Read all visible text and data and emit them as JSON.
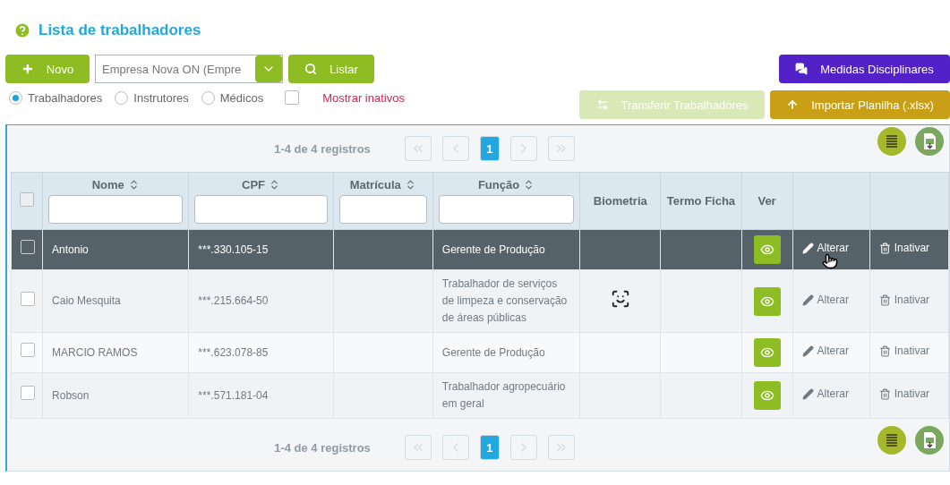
{
  "title": "Lista de trabalhadores",
  "toolbar": {
    "new_button": "Novo",
    "company_select": {
      "value": "Empresa Nova ON (Empre"
    },
    "list_button": "Listar",
    "disciplinary_button": "Medidas Disciplinares"
  },
  "filters": [
    {
      "label": "Trabalhadores",
      "selected": true
    },
    {
      "label": "Instrutores",
      "selected": false
    },
    {
      "label": "Médicos",
      "selected": false
    }
  ],
  "show_inactive": {
    "label": "Mostrar inativos",
    "checked": false
  },
  "actions": [
    {
      "label": "Transferir Trabalhadores",
      "kind": "transfer",
      "disabled": true
    },
    {
      "label": "Importar Planilha (.xlsx)",
      "kind": "import",
      "disabled": false
    }
  ],
  "pagination_top": {
    "summary": "1-4 de 4 registros",
    "pages": [
      {
        "label": "1",
        "selected": true
      }
    ]
  },
  "table": {
    "select_all": {
      "checked": false
    },
    "columns": [
      {
        "label": "Nome",
        "sortable": true,
        "filter": true
      },
      {
        "label": "CPF",
        "sortable": true,
        "filter": true
      },
      {
        "label": "Matrícula",
        "sortable": true,
        "filter": true
      },
      {
        "label": "Função",
        "sortable": true,
        "filter": true
      },
      {
        "label": "Biometria",
        "sortable": false,
        "filter": false
      },
      {
        "label": "Termo Ficha",
        "sortable": false,
        "filter": false
      },
      {
        "label": "Ver",
        "sortable": false,
        "filter": false
      }
    ],
    "rows": [
      {
        "name": "Antonio",
        "cpf": "***.330.105-15",
        "role": "Gerente de Produção",
        "biometry": false,
        "checked": false,
        "highlighted": true,
        "edit": "Alterar",
        "deactivate": "Inativar"
      },
      {
        "name": "Caio Mesquita",
        "cpf": "***.215.664-50",
        "role": "Trabalhador de serviços de limpeza e conservação de áreas públicas",
        "biometry": true,
        "checked": false,
        "highlighted": false,
        "edit": "Alterar",
        "deactivate": "Inativar"
      },
      {
        "name": "MARCIO RAMOS",
        "cpf": "***.623.078-85",
        "role": "Gerente de Produção",
        "biometry": false,
        "checked": false,
        "highlighted": false,
        "edit": "Alterar",
        "deactivate": "Inativar"
      },
      {
        "name": "Robson",
        "cpf": "***.571.181-04",
        "role": "Trabalhador agropecuário em geral",
        "biometry": false,
        "checked": false,
        "highlighted": false,
        "edit": "Alterar",
        "deactivate": "Inativar"
      }
    ]
  },
  "pagination_bottom": {
    "summary": "1-4 de 4 registros",
    "pages": [
      {
        "label": "1",
        "selected": true
      }
    ]
  }
}
